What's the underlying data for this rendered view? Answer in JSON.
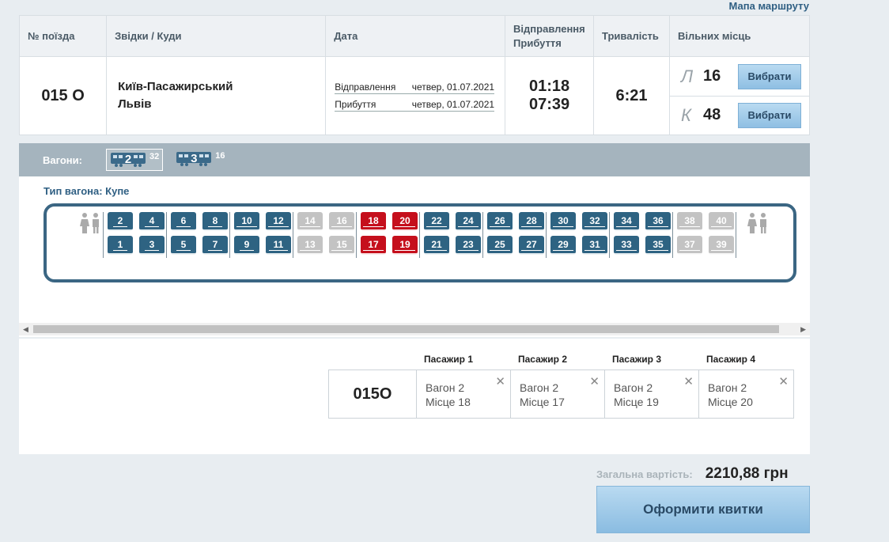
{
  "map_link": "Мапа маршруту",
  "table": {
    "headers": [
      "№ поїзда",
      "Звідки / Куди",
      "Дата",
      "Відправлення Прибуття",
      "Тривалість",
      "Вільних місць"
    ],
    "train": {
      "number": "015 О",
      "from": "Київ-Пасажирський",
      "to": "Львів",
      "dep_label": "Відправлення",
      "dep_date": "четвер, 01.07.2021",
      "arr_label": "Прибуття",
      "arr_date": "четвер, 01.07.2021",
      "dep_time": "01:18",
      "arr_time": "07:39",
      "duration": "6:21",
      "classes": [
        {
          "code": "Л",
          "count": "16",
          "button": "Вибрати"
        },
        {
          "code": "К",
          "count": "48",
          "button": "Вибрати"
        }
      ]
    }
  },
  "wagons": {
    "label": "Вагони:",
    "items": [
      {
        "number": "2",
        "free": "32",
        "selected": true
      },
      {
        "number": "3",
        "free": "16",
        "selected": false
      }
    ]
  },
  "coach": {
    "type_label": "Тип вагона: Купе",
    "seats": [
      {
        "n": "1",
        "s": "f"
      },
      {
        "n": "2",
        "s": "f"
      },
      {
        "n": "3",
        "s": "f"
      },
      {
        "n": "4",
        "s": "f"
      },
      {
        "n": "5",
        "s": "f"
      },
      {
        "n": "6",
        "s": "f"
      },
      {
        "n": "7",
        "s": "f"
      },
      {
        "n": "8",
        "s": "f"
      },
      {
        "n": "9",
        "s": "f"
      },
      {
        "n": "10",
        "s": "f"
      },
      {
        "n": "11",
        "s": "f"
      },
      {
        "n": "12",
        "s": "f"
      },
      {
        "n": "13",
        "s": "o"
      },
      {
        "n": "14",
        "s": "o"
      },
      {
        "n": "15",
        "s": "o"
      },
      {
        "n": "16",
        "s": "o"
      },
      {
        "n": "17",
        "s": "s"
      },
      {
        "n": "18",
        "s": "s"
      },
      {
        "n": "19",
        "s": "s"
      },
      {
        "n": "20",
        "s": "s"
      },
      {
        "n": "21",
        "s": "f"
      },
      {
        "n": "22",
        "s": "f"
      },
      {
        "n": "23",
        "s": "f"
      },
      {
        "n": "24",
        "s": "f"
      },
      {
        "n": "25",
        "s": "f"
      },
      {
        "n": "26",
        "s": "f"
      },
      {
        "n": "27",
        "s": "f"
      },
      {
        "n": "28",
        "s": "f"
      },
      {
        "n": "29",
        "s": "f"
      },
      {
        "n": "30",
        "s": "f"
      },
      {
        "n": "31",
        "s": "f"
      },
      {
        "n": "32",
        "s": "f"
      },
      {
        "n": "33",
        "s": "f"
      },
      {
        "n": "34",
        "s": "f"
      },
      {
        "n": "35",
        "s": "f"
      },
      {
        "n": "36",
        "s": "f"
      },
      {
        "n": "37",
        "s": "o"
      },
      {
        "n": "38",
        "s": "o"
      },
      {
        "n": "39",
        "s": "o"
      },
      {
        "n": "40",
        "s": "o"
      }
    ],
    "colors": {
      "free": "#2e6382",
      "occupied": "#c3c3c3",
      "selected": "#c50f1c"
    }
  },
  "passengers": {
    "train_number": "015О",
    "items": [
      {
        "title": "Пасажир 1",
        "wagon": "Вагон 2",
        "seat": "Місце 18"
      },
      {
        "title": "Пасажир 2",
        "wagon": "Вагон 2",
        "seat": "Місце 17"
      },
      {
        "title": "Пасажир 3",
        "wagon": "Вагон 2",
        "seat": "Місце 19"
      },
      {
        "title": "Пасажир 4",
        "wagon": "Вагон 2",
        "seat": "Місце 20"
      }
    ]
  },
  "total": {
    "label": "Загальна вартість:",
    "value": "2210,88 грн"
  },
  "buy_button": "Оформити квитки"
}
